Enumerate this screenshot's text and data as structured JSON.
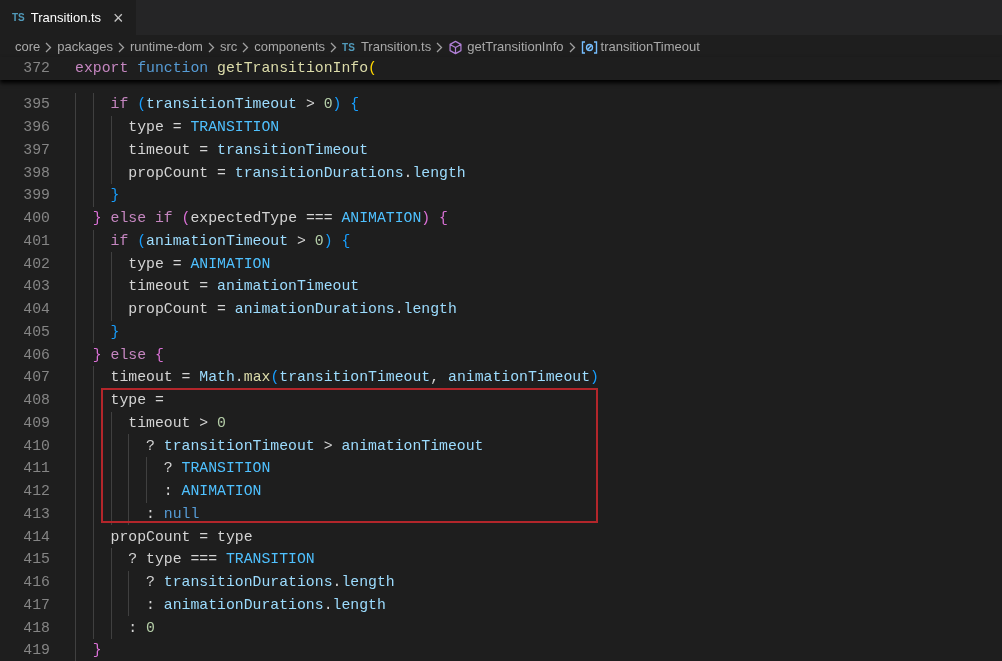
{
  "tabs": [
    {
      "badge": "TS",
      "label": "Transition.ts",
      "selected": true,
      "close": "×"
    }
  ],
  "breadcrumb": [
    {
      "kind": "folder",
      "label": "core"
    },
    {
      "kind": "folder",
      "label": "packages"
    },
    {
      "kind": "folder",
      "label": "runtime-dom"
    },
    {
      "kind": "folder",
      "label": "src"
    },
    {
      "kind": "folder",
      "label": "components"
    },
    {
      "kind": "file",
      "badge": "TS",
      "label": "Transition.ts"
    },
    {
      "kind": "function",
      "label": "getTransitionInfo"
    },
    {
      "kind": "variable",
      "label": "transitionTimeout"
    }
  ],
  "sticky_line": {
    "number": "372",
    "tokens": [
      {
        "kind": "kw",
        "text": "export"
      },
      {
        "kind": "st",
        "text": " function"
      },
      {
        "kind": "fn",
        "text": " getTransitionInfo"
      },
      {
        "kind": "b1",
        "text": "("
      }
    ]
  },
  "lines": [
    {
      "number": "395",
      "boxed": false,
      "tokens": [
        {
          "kind": "kw",
          "text": "    if"
        },
        {
          "kind": "b3",
          "text": " ("
        },
        {
          "kind": "v",
          "text": "transitionTimeout"
        },
        {
          "kind": "p",
          "text": " > "
        },
        {
          "kind": "n",
          "text": "0"
        },
        {
          "kind": "b3",
          "text": ")"
        },
        {
          "kind": "b3",
          "text": " {"
        }
      ]
    },
    {
      "number": "396",
      "boxed": false,
      "tokens": [
        {
          "kind": "p",
          "text": "      type = "
        },
        {
          "kind": "c",
          "text": "TRANSITION"
        }
      ]
    },
    {
      "number": "397",
      "boxed": false,
      "tokens": [
        {
          "kind": "p",
          "text": "      timeout = "
        },
        {
          "kind": "v",
          "text": "transitionTimeout"
        }
      ]
    },
    {
      "number": "398",
      "boxed": false,
      "tokens": [
        {
          "kind": "p",
          "text": "      propCount = "
        },
        {
          "kind": "v",
          "text": "transitionDurations"
        },
        {
          "kind": "p",
          "text": "."
        },
        {
          "kind": "v",
          "text": "length"
        }
      ]
    },
    {
      "number": "399",
      "boxed": false,
      "tokens": [
        {
          "kind": "b3",
          "text": "    }"
        }
      ]
    },
    {
      "number": "400",
      "boxed": false,
      "tokens": [
        {
          "kind": "b2",
          "text": "  }"
        },
        {
          "kind": "kw",
          "text": " else"
        },
        {
          "kind": "kw",
          "text": " if"
        },
        {
          "kind": "b2",
          "text": " ("
        },
        {
          "kind": "p",
          "text": "expectedType === "
        },
        {
          "kind": "c",
          "text": "ANIMATION"
        },
        {
          "kind": "b2",
          "text": ")"
        },
        {
          "kind": "b2",
          "text": " {"
        }
      ]
    },
    {
      "number": "401",
      "boxed": false,
      "tokens": [
        {
          "kind": "kw",
          "text": "    if"
        },
        {
          "kind": "b3",
          "text": " ("
        },
        {
          "kind": "v",
          "text": "animationTimeout"
        },
        {
          "kind": "p",
          "text": " > "
        },
        {
          "kind": "n",
          "text": "0"
        },
        {
          "kind": "b3",
          "text": ")"
        },
        {
          "kind": "b3",
          "text": " {"
        }
      ]
    },
    {
      "number": "402",
      "boxed": false,
      "tokens": [
        {
          "kind": "p",
          "text": "      type = "
        },
        {
          "kind": "c",
          "text": "ANIMATION"
        }
      ]
    },
    {
      "number": "403",
      "boxed": false,
      "tokens": [
        {
          "kind": "p",
          "text": "      timeout = "
        },
        {
          "kind": "v",
          "text": "animationTimeout"
        }
      ]
    },
    {
      "number": "404",
      "boxed": false,
      "tokens": [
        {
          "kind": "p",
          "text": "      propCount = "
        },
        {
          "kind": "v",
          "text": "animationDurations"
        },
        {
          "kind": "p",
          "text": "."
        },
        {
          "kind": "v",
          "text": "length"
        }
      ]
    },
    {
      "number": "405",
      "boxed": false,
      "tokens": [
        {
          "kind": "b3",
          "text": "    }"
        }
      ]
    },
    {
      "number": "406",
      "boxed": false,
      "tokens": [
        {
          "kind": "b2",
          "text": "  }"
        },
        {
          "kind": "kw",
          "text": " else"
        },
        {
          "kind": "b2",
          "text": " {"
        }
      ]
    },
    {
      "number": "407",
      "boxed": false,
      "tokens": [
        {
          "kind": "p",
          "text": "    timeout = "
        },
        {
          "kind": "v",
          "text": "Math"
        },
        {
          "kind": "p",
          "text": "."
        },
        {
          "kind": "fn",
          "text": "max"
        },
        {
          "kind": "b3",
          "text": "("
        },
        {
          "kind": "v",
          "text": "transitionTimeout"
        },
        {
          "kind": "p",
          "text": ", "
        },
        {
          "kind": "v",
          "text": "animationTimeout"
        },
        {
          "kind": "b3",
          "text": ")"
        }
      ]
    },
    {
      "number": "408",
      "boxed": true,
      "tokens": [
        {
          "kind": "p",
          "text": "    type ="
        }
      ]
    },
    {
      "number": "409",
      "boxed": true,
      "tokens": [
        {
          "kind": "p",
          "text": "      timeout > "
        },
        {
          "kind": "n",
          "text": "0"
        }
      ]
    },
    {
      "number": "410",
      "boxed": true,
      "tokens": [
        {
          "kind": "p",
          "text": "        ? "
        },
        {
          "kind": "v",
          "text": "transitionTimeout"
        },
        {
          "kind": "p",
          "text": " > "
        },
        {
          "kind": "v",
          "text": "animationTimeout"
        }
      ]
    },
    {
      "number": "411",
      "boxed": true,
      "tokens": [
        {
          "kind": "p",
          "text": "          ? "
        },
        {
          "kind": "c",
          "text": "TRANSITION"
        }
      ]
    },
    {
      "number": "412",
      "boxed": true,
      "tokens": [
        {
          "kind": "p",
          "text": "          : "
        },
        {
          "kind": "c",
          "text": "ANIMATION"
        }
      ]
    },
    {
      "number": "413",
      "boxed": true,
      "tokens": [
        {
          "kind": "p",
          "text": "        : "
        },
        {
          "kind": "st",
          "text": "null"
        }
      ]
    },
    {
      "number": "414",
      "boxed": false,
      "tokens": [
        {
          "kind": "p",
          "text": "    propCount = type"
        }
      ]
    },
    {
      "number": "415",
      "boxed": false,
      "tokens": [
        {
          "kind": "p",
          "text": "      ? type === "
        },
        {
          "kind": "c",
          "text": "TRANSITION"
        }
      ]
    },
    {
      "number": "416",
      "boxed": false,
      "tokens": [
        {
          "kind": "p",
          "text": "        ? "
        },
        {
          "kind": "v",
          "text": "transitionDurations"
        },
        {
          "kind": "p",
          "text": "."
        },
        {
          "kind": "v",
          "text": "length"
        }
      ]
    },
    {
      "number": "417",
      "boxed": false,
      "tokens": [
        {
          "kind": "p",
          "text": "        : "
        },
        {
          "kind": "v",
          "text": "animationDurations"
        },
        {
          "kind": "p",
          "text": "."
        },
        {
          "kind": "v",
          "text": "length"
        }
      ]
    },
    {
      "number": "418",
      "boxed": false,
      "tokens": [
        {
          "kind": "p",
          "text": "      : "
        },
        {
          "kind": "n",
          "text": "0"
        }
      ]
    },
    {
      "number": "419",
      "boxed": false,
      "tokens": [
        {
          "kind": "b2",
          "text": "  }"
        }
      ]
    }
  ]
}
